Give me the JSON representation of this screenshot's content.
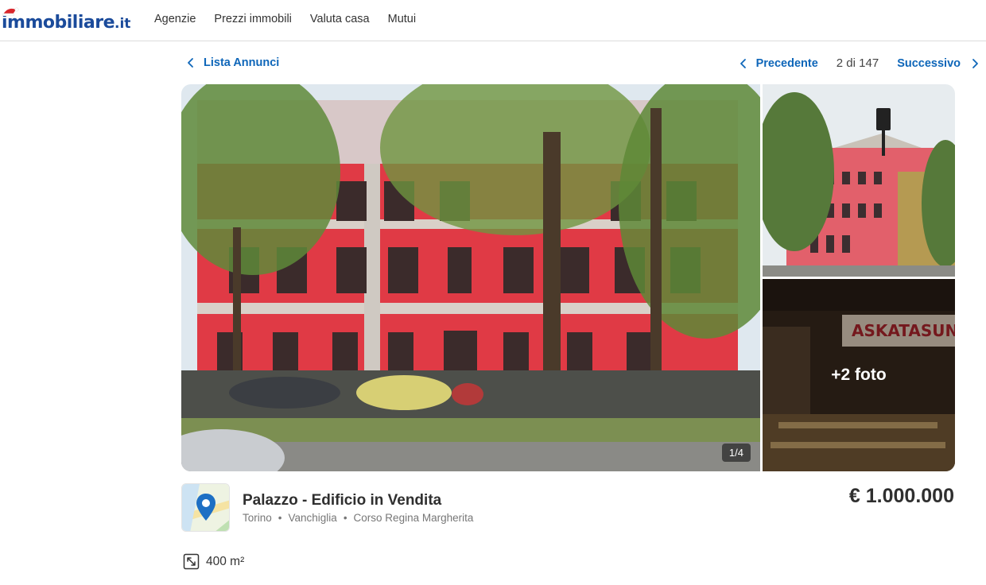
{
  "brand": {
    "name": "immobiliare",
    "tld": ".it",
    "color": "#1b4b9b",
    "accent": "#0e66b9"
  },
  "nav": [
    "Agenzie",
    "Prezzi immobili",
    "Valuta casa",
    "Mutui"
  ],
  "subnav": {
    "back_label": "Lista Annunci",
    "prev_label": "Precedente",
    "position": "2 di 147",
    "next_label": "Successivo"
  },
  "gallery": {
    "counter": "1/4",
    "more_label": "+2 foto",
    "side_bottom_sign": "ASKATASUNA"
  },
  "listing": {
    "title": "Palazzo - Edificio in Vendita",
    "location": [
      "Torino",
      "Vanchiglia",
      "Corso Regina Margherita"
    ],
    "location_separator": "•",
    "price": "€ 1.000.000",
    "area": "400 m²"
  },
  "icons": {
    "back": "chevron-left-icon",
    "prev": "chevron-left-icon",
    "next": "chevron-right-icon",
    "map": "map-pin-icon",
    "area": "expand-arrows-icon"
  }
}
